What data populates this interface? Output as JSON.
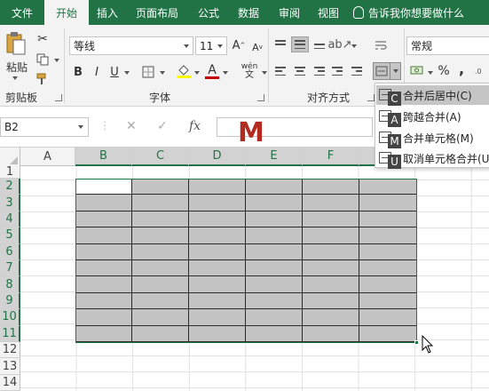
{
  "menubar": {
    "tabs": [
      {
        "label": "文件",
        "active": false
      },
      {
        "label": "开始",
        "active": true
      },
      {
        "label": "插入",
        "active": false
      },
      {
        "label": "页面布局",
        "active": false
      },
      {
        "label": "公式",
        "active": false
      },
      {
        "label": "数据",
        "active": false
      },
      {
        "label": "审阅",
        "active": false
      },
      {
        "label": "视图",
        "active": false
      }
    ],
    "tellme": "告诉我你想要做什么"
  },
  "ribbon": {
    "clipboard": {
      "paste": "粘贴",
      "label": "剪贴板"
    },
    "font": {
      "name": "等线",
      "size": "11",
      "bold": "B",
      "italic": "I",
      "underline": "U",
      "label": "字体",
      "font_color": "#c00000",
      "highlight_color": "#ffff00",
      "wen": "wén"
    },
    "alignment": {
      "label": "对齐方式"
    },
    "number": {
      "format": "常规",
      "percent": "%",
      "comma": ","
    }
  },
  "formula_bar": {
    "name_box": "B2",
    "cancel": "✕",
    "enter": "✓",
    "fx": "fx",
    "value": ""
  },
  "keytip_overlay": "M",
  "grid": {
    "columns": [
      "A",
      "B",
      "C",
      "D",
      "E",
      "F"
    ],
    "rows": [
      "1",
      "2",
      "3",
      "4",
      "5",
      "6",
      "7",
      "8",
      "9",
      "10",
      "11",
      "12",
      "13",
      "14"
    ],
    "selected_range": "B2:G11",
    "active_cell": "B2"
  },
  "merge_menu": {
    "items": [
      {
        "label": "合并后居中(C)",
        "keytip": "C",
        "highlighted": true
      },
      {
        "label": "跨越合并(A)",
        "keytip": "A",
        "highlighted": false
      },
      {
        "label": "合并单元格(M)",
        "keytip": "M",
        "highlighted": false
      },
      {
        "label": "取消单元格合并(U)",
        "keytip": "U",
        "highlighted": false
      }
    ]
  },
  "colors": {
    "accent": "#217346",
    "cell_fill": "#c4c4c4"
  }
}
